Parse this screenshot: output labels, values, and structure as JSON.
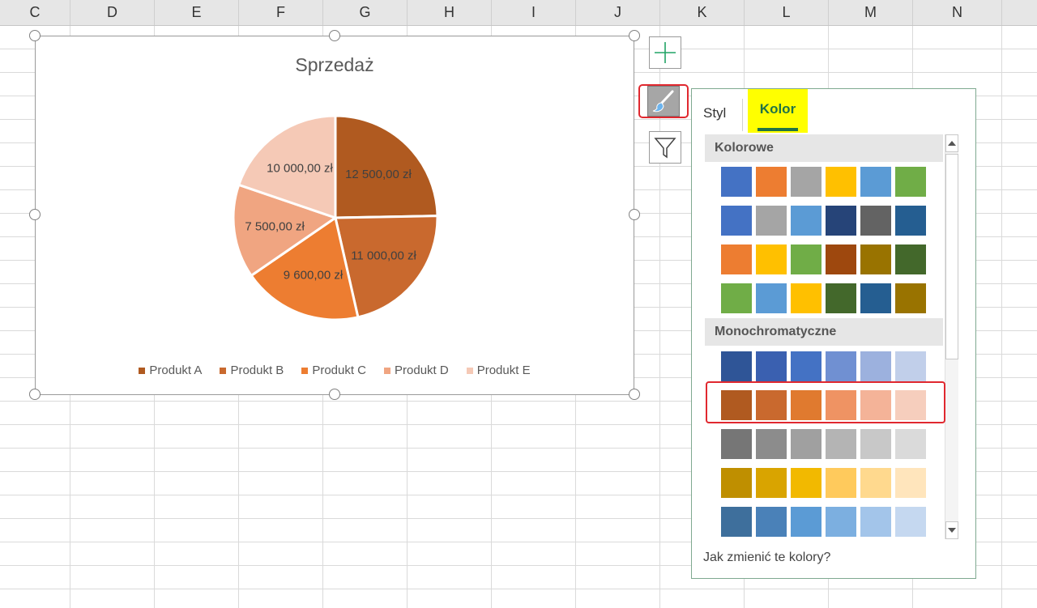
{
  "columns": [
    "C",
    "D",
    "E",
    "F",
    "G",
    "H",
    "I",
    "J",
    "K",
    "L",
    "M",
    "N"
  ],
  "chart": {
    "selection_color": "#808080"
  },
  "chart_data": {
    "type": "pie",
    "title": "Sprzedaż",
    "categories": [
      "Produkt A",
      "Produkt B",
      "Produkt C",
      "Produkt D",
      "Produkt E"
    ],
    "values": [
      12500,
      11000,
      9600,
      7500,
      10000
    ],
    "data_labels": [
      "12 500,00 zł",
      "11 000,00 zł",
      "9 600,00 zł",
      "7 500,00 zł",
      "10 000,00 zł"
    ],
    "colors": [
      "#b05a20",
      "#c9692e",
      "#ed7d31",
      "#f0a581",
      "#f5c9b6"
    ],
    "legend_position": "bottom"
  },
  "side_buttons": {
    "elements_icon": "plus-icon",
    "styles_icon": "brush-icon",
    "filter_icon": "funnel-icon"
  },
  "panel": {
    "tab_style": "Styl",
    "tab_color": "Kolor",
    "section_colorful": "Kolorowe",
    "section_mono": "Monochromatyczne",
    "help_link": "Jak zmienić te kolory?",
    "tab_highlight": "#ffff00",
    "active_underline": "#217346",
    "colorful_rows": [
      [
        "#4472c4",
        "#ed7d31",
        "#a5a5a5",
        "#ffc000",
        "#5b9bd5",
        "#70ad47"
      ],
      [
        "#4472c4",
        "#a5a5a5",
        "#5b9bd5",
        "#264478",
        "#636363",
        "#255e91"
      ],
      [
        "#ed7d31",
        "#ffc000",
        "#70ad47",
        "#9e480e",
        "#997300",
        "#43682b"
      ],
      [
        "#70ad47",
        "#5b9bd5",
        "#ffc000",
        "#43682b",
        "#255e91",
        "#997300"
      ]
    ],
    "mono_rows": [
      [
        "#2f5597",
        "#3a60b0",
        "#4472c4",
        "#7090d2",
        "#9cb1de",
        "#c1cfea"
      ],
      [
        "#b05a20",
        "#c9692e",
        "#e07a2f",
        "#ef9363",
        "#f4b398",
        "#f6cebd"
      ],
      [
        "#767676",
        "#8c8c8c",
        "#a0a0a0",
        "#b4b4b4",
        "#c8c8c8",
        "#dadada"
      ],
      [
        "#bf8f00",
        "#d9a400",
        "#f2b900",
        "#ffca5c",
        "#ffd98e",
        "#ffe5bc"
      ],
      [
        "#3e6f9c",
        "#4a81b8",
        "#5b9bd5",
        "#7cafe0",
        "#a3c5ea",
        "#c5d8f0"
      ]
    ]
  }
}
